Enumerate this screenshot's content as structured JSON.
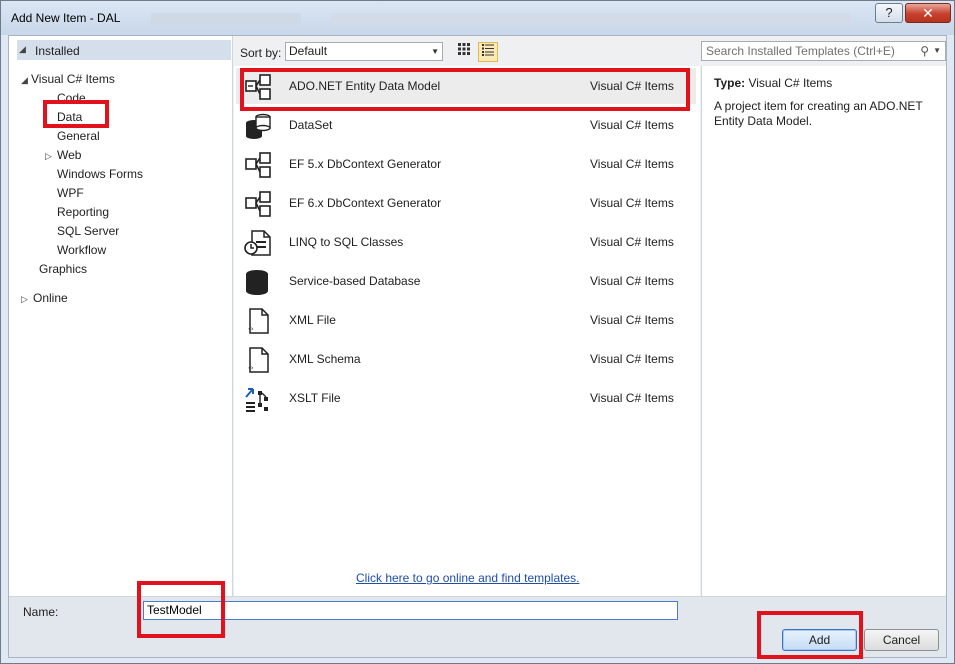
{
  "window": {
    "title": "Add New Item - DAL",
    "help_label": "?",
    "close_label": "✕"
  },
  "tree": {
    "installed": "Installed",
    "visual_csharp_items": "Visual C# Items",
    "children": [
      "Code",
      "Data",
      "General",
      "Web",
      "Windows Forms",
      "WPF",
      "Reporting",
      "SQL Server",
      "Workflow"
    ],
    "graphics": "Graphics",
    "online": "Online"
  },
  "toolbar": {
    "sort_label": "Sort by:",
    "sort_value": "Default"
  },
  "search": {
    "placeholder": "Search Installed Templates (Ctrl+E)"
  },
  "items": [
    {
      "name": "ADO.NET Entity Data Model",
      "category": "Visual C# Items",
      "icon": "entity-model-icon"
    },
    {
      "name": "DataSet",
      "category": "Visual C# Items",
      "icon": "dataset-icon"
    },
    {
      "name": "EF 5.x DbContext Generator",
      "category": "Visual C# Items",
      "icon": "entity-model-icon"
    },
    {
      "name": "EF 6.x DbContext Generator",
      "category": "Visual C# Items",
      "icon": "entity-model-icon"
    },
    {
      "name": "LINQ to SQL Classes",
      "category": "Visual C# Items",
      "icon": "linq-icon"
    },
    {
      "name": "Service-based Database",
      "category": "Visual C# Items",
      "icon": "database-icon"
    },
    {
      "name": "XML File",
      "category": "Visual C# Items",
      "icon": "xml-file-icon"
    },
    {
      "name": "XML Schema",
      "category": "Visual C# Items",
      "icon": "xml-schema-icon"
    },
    {
      "name": "XSLT File",
      "category": "Visual C# Items",
      "icon": "xslt-file-icon"
    }
  ],
  "online_link": "Click here to go online and find templates.",
  "details": {
    "type_label": "Type:",
    "type_value": "Visual C# Items",
    "description": "A project item for creating an ADO.NET Entity Data Model."
  },
  "footer": {
    "name_label": "Name:",
    "name_value": "TestModel",
    "add_label": "Add",
    "cancel_label": "Cancel"
  },
  "colors": {
    "highlight": "#e2111b",
    "link": "#1f4ea8",
    "selected_row": "#ececec"
  }
}
